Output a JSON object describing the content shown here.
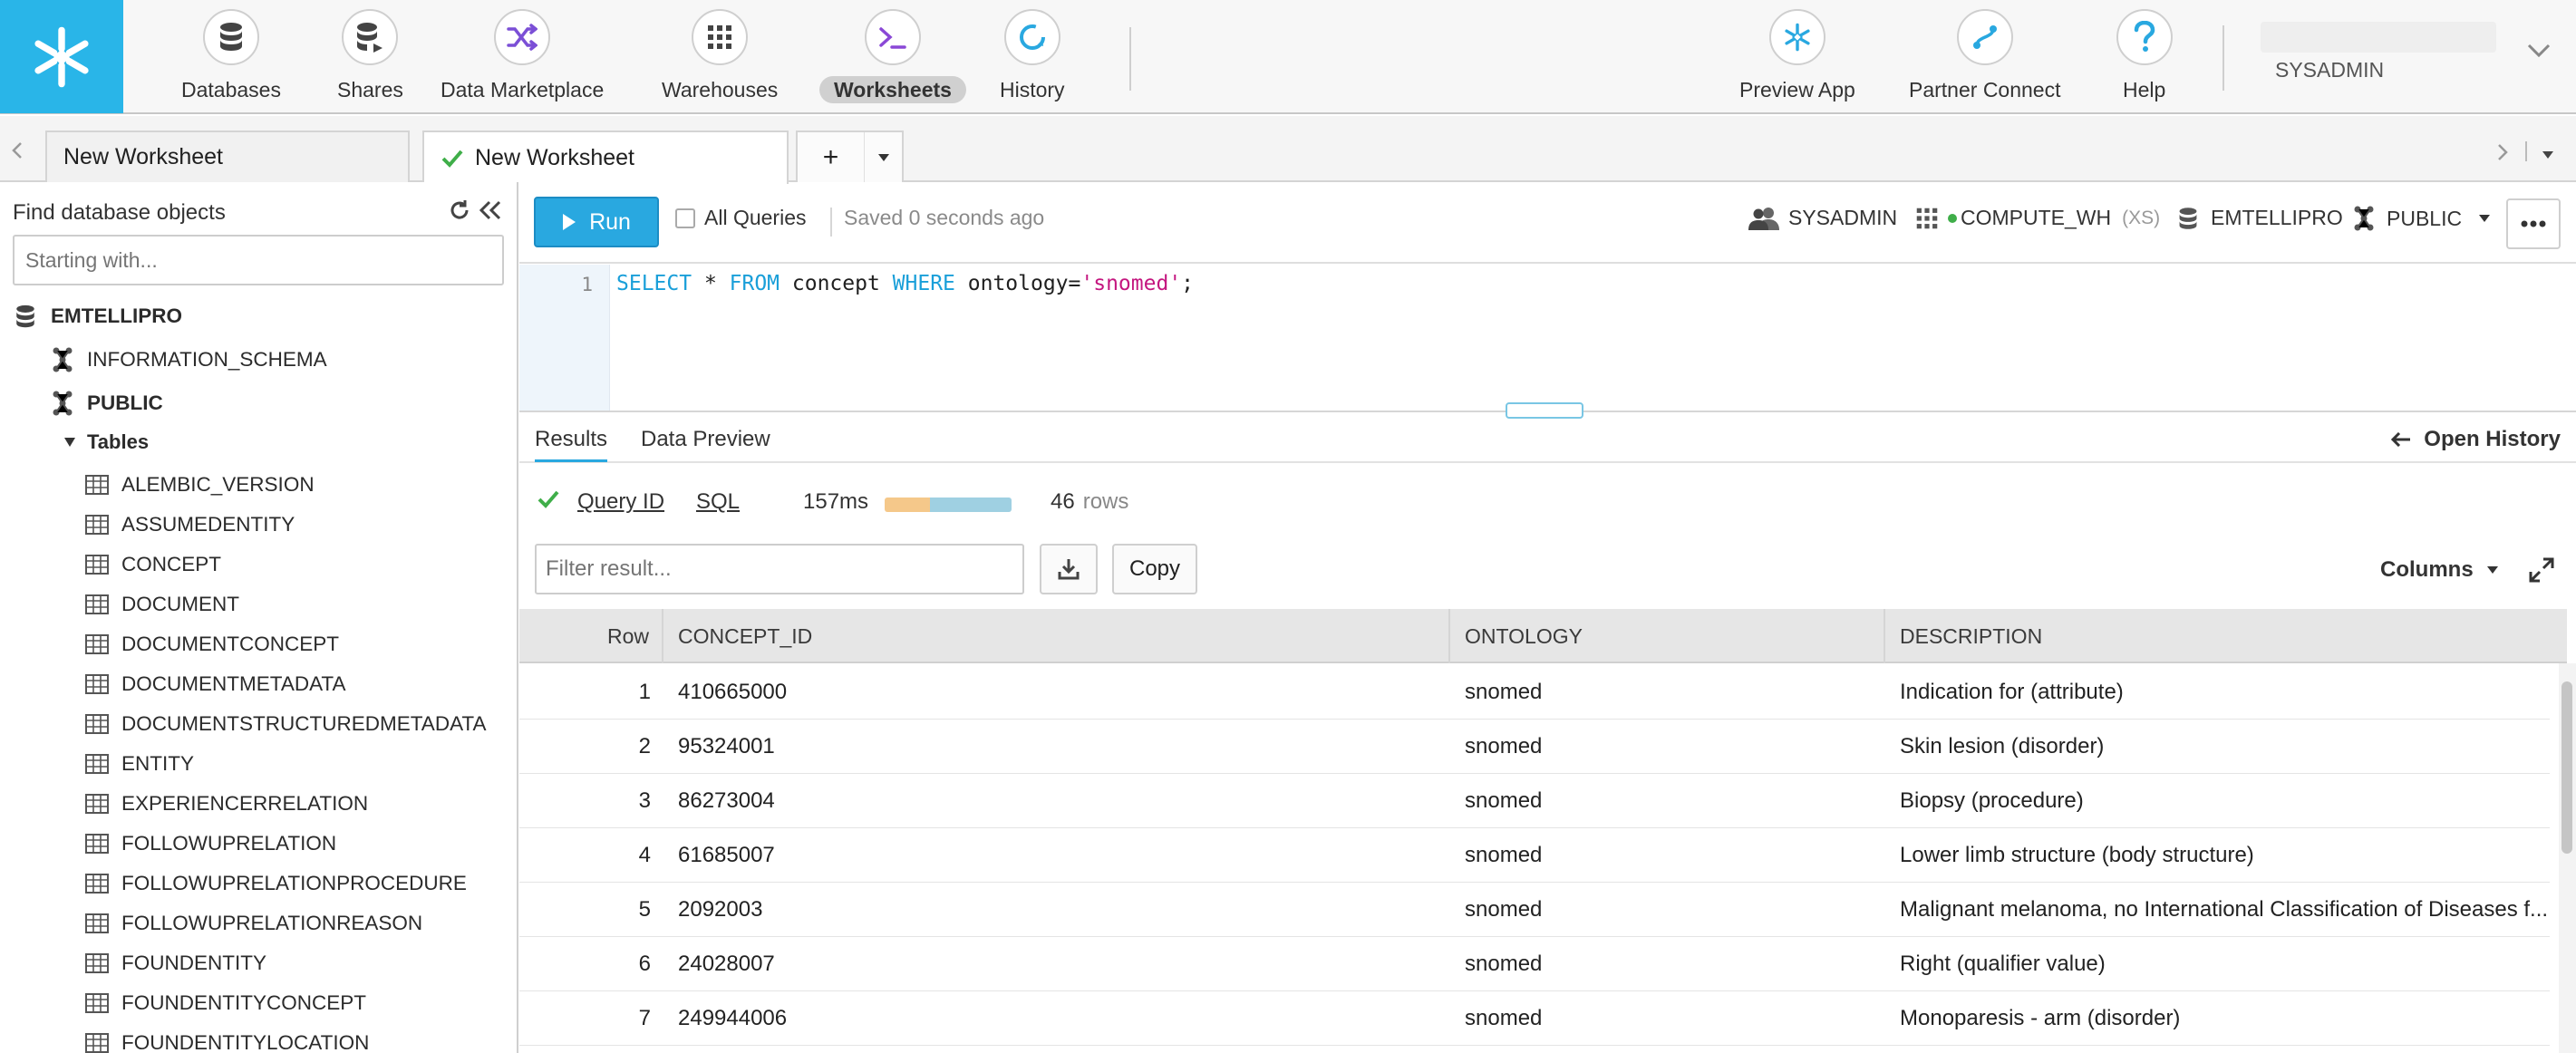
{
  "nav": {
    "items": [
      {
        "label": "Databases",
        "icon": "database-icon"
      },
      {
        "label": "Shares",
        "icon": "shares-icon"
      },
      {
        "label": "Data Marketplace",
        "icon": "marketplace-icon"
      },
      {
        "label": "Warehouses",
        "icon": "warehouse-icon"
      },
      {
        "label": "Worksheets",
        "icon": "terminal-icon",
        "active": true
      },
      {
        "label": "History",
        "icon": "history-icon"
      }
    ],
    "right": [
      {
        "label": "Preview App",
        "icon": "snowflake-icon"
      },
      {
        "label": "Partner Connect",
        "icon": "partner-connect-icon"
      },
      {
        "label": "Help",
        "icon": "help-icon"
      }
    ],
    "user": "SYSADMIN",
    "accent": "#29b5e8"
  },
  "tabs": {
    "items": [
      {
        "label": "New Worksheet",
        "active": false
      },
      {
        "label": "New Worksheet",
        "active": true
      }
    ],
    "add": "+"
  },
  "sidebar": {
    "title": "Find database objects",
    "search_placeholder": "Starting with...",
    "database": "EMTELLIPRO",
    "schemas": [
      "INFORMATION_SCHEMA",
      "PUBLIC"
    ],
    "tables_label": "Tables",
    "tables": [
      "ALEMBIC_VERSION",
      "ASSUMEDENTITY",
      "CONCEPT",
      "DOCUMENT",
      "DOCUMENTCONCEPT",
      "DOCUMENTMETADATA",
      "DOCUMENTSTRUCTUREDMETADATA",
      "ENTITY",
      "EXPERIENCERRELATION",
      "FOLLOWUPRELATION",
      "FOLLOWUPRELATIONPROCEDURE",
      "FOLLOWUPRELATIONREASON",
      "FOUNDENTITY",
      "FOUNDENTITYCONCEPT",
      "FOUNDENTITYLOCATION"
    ]
  },
  "toolbar": {
    "run": "Run",
    "all_queries": "All Queries",
    "saved": "Saved 0 seconds ago",
    "role": "SYSADMIN",
    "warehouse": "COMPUTE_WH",
    "warehouse_size": "(XS)",
    "database": "EMTELLIPRO",
    "schema": "PUBLIC"
  },
  "editor": {
    "line": "1",
    "tokens": [
      {
        "t": "SELECT",
        "c": "kw"
      },
      {
        "t": " * ",
        "c": ""
      },
      {
        "t": "FROM",
        "c": "kw"
      },
      {
        "t": " concept ",
        "c": ""
      },
      {
        "t": "WHERE",
        "c": "kw"
      },
      {
        "t": " ontology=",
        "c": ""
      },
      {
        "t": "'snomed'",
        "c": "str"
      },
      {
        "t": ";",
        "c": ""
      }
    ]
  },
  "results": {
    "tabs": [
      "Results",
      "Data Preview"
    ],
    "open_history": "Open History",
    "query_id": "Query ID",
    "sql": "SQL",
    "duration": "157ms",
    "row_count": "46",
    "rows_label": "rows",
    "filter_placeholder": "Filter result...",
    "copy": "Copy",
    "columns": "Columns",
    "headers": [
      "Row",
      "CONCEPT_ID",
      "ONTOLOGY",
      "DESCRIPTION"
    ],
    "rows": [
      [
        "1",
        "410665000",
        "snomed",
        "Indication for (attribute)"
      ],
      [
        "2",
        "95324001",
        "snomed",
        "Skin lesion (disorder)"
      ],
      [
        "3",
        "86273004",
        "snomed",
        "Biopsy (procedure)"
      ],
      [
        "4",
        "61685007",
        "snomed",
        "Lower limb structure (body structure)"
      ],
      [
        "5",
        "2092003",
        "snomed",
        "Malignant melanoma, no International Classification of Diseases f..."
      ],
      [
        "6",
        "24028007",
        "snomed",
        "Right (qualifier value)"
      ],
      [
        "7",
        "249944006",
        "snomed",
        "Monoparesis - arm (disorder)"
      ]
    ]
  }
}
